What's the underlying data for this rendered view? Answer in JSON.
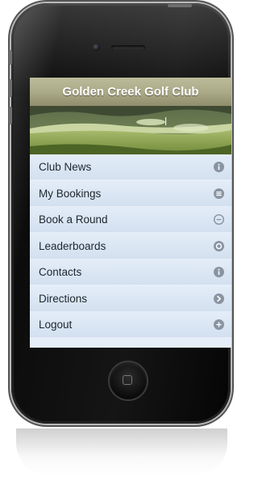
{
  "app": {
    "title": "Golden Creek Golf Club"
  },
  "colors": {
    "header": "#a9a886",
    "menu_item": "#dbe6f3",
    "menu_text": "#1c2630",
    "icon": "#8894a2"
  },
  "menu": {
    "items": [
      {
        "label": "Club News",
        "icon": "info-icon"
      },
      {
        "label": "My Bookings",
        "icon": "list-icon"
      },
      {
        "label": "Book a Round",
        "icon": "minus-icon"
      },
      {
        "label": "Leaderboards",
        "icon": "circle-icon"
      },
      {
        "label": "Contacts",
        "icon": "info-icon"
      },
      {
        "label": "Directions",
        "icon": "arrow-right-icon"
      },
      {
        "label": "Logout",
        "icon": "plus-icon"
      }
    ]
  }
}
